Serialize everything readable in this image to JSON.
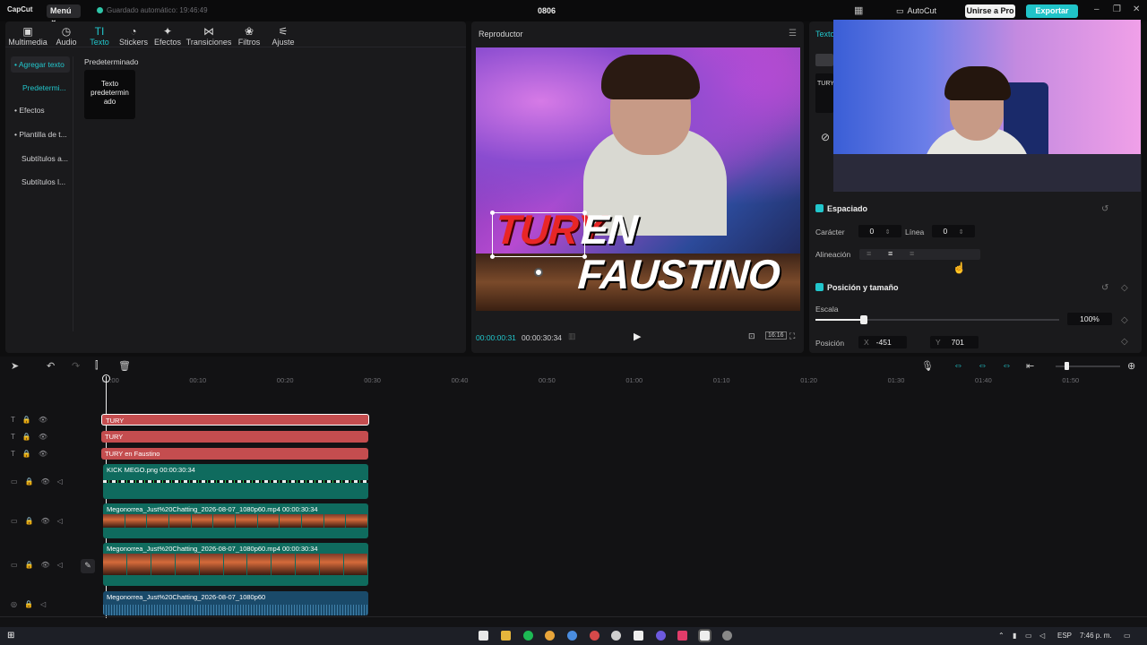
{
  "app": {
    "logo": "CapCut",
    "menu_label": "Menú ⌄",
    "autosave": "Guardado automático: 19:46:49",
    "project_title": "0806",
    "autocut_label": "AutoCut",
    "pro_label": "Unirse a Pro",
    "export_label": "Exportar"
  },
  "tabs": [
    {
      "label": "Multimedia",
      "icon": "media-icon"
    },
    {
      "label": "Audio",
      "icon": "audio-icon"
    },
    {
      "label": "Texto",
      "icon": "text-icon"
    },
    {
      "label": "Stickers",
      "icon": "sticker-icon"
    },
    {
      "label": "Efectos",
      "icon": "effects-icon"
    },
    {
      "label": "Transiciones",
      "icon": "transition-icon"
    },
    {
      "label": "Filtros",
      "icon": "filter-icon"
    },
    {
      "label": "Ajuste",
      "icon": "adjust-icon"
    }
  ],
  "sidenav": [
    "• Agregar texto",
    "Predetermi...",
    "• Efectos",
    "• Plantilla de t...",
    "Subtítulos a...",
    "Subtítulos l..."
  ],
  "presets": {
    "title": "Predeterminado",
    "card": "Texto predetermin ado"
  },
  "player": {
    "title": "Reproductor",
    "time_current": "00:00:00:31",
    "time_total": "00:00:30:34",
    "ratio": "16:16",
    "overlay_red": "TURY",
    "overlay_white": "EN FAUSTINO"
  },
  "right": {
    "tab": "Texto",
    "spacing": {
      "title": "Espaciado",
      "char_label": "Carácter",
      "char_value": "0",
      "line_label": "Línea",
      "line_value": "0",
      "align_label": "Alineación"
    },
    "pos": {
      "title": "Posición y tamaño",
      "scale_label": "Escala",
      "scale_value": "100%",
      "scale_fraction": 0.2,
      "position_label": "Posición",
      "x_label": "X",
      "x_value": "-451",
      "y_label": "Y",
      "y_value": "701"
    }
  },
  "timeline": {
    "ruler": [
      "00:00",
      "00:10",
      "00:20",
      "00:30",
      "00:40",
      "00:50",
      "01:00",
      "01:10",
      "01:20",
      "01:30",
      "01:40",
      "01:50"
    ],
    "tracks": [
      {
        "type": "text",
        "label": "TURY"
      },
      {
        "type": "text",
        "label": "TURY"
      },
      {
        "type": "text",
        "label": "TURY en Faustino"
      },
      {
        "type": "image",
        "label": "KICK MEGO.png  00:00:30:34"
      },
      {
        "type": "video",
        "label": "Megonorrea_Just%20Chatting_2026-08-07_1080p60.mp4  00:00:30:34"
      },
      {
        "type": "video",
        "label": "Megonorrea_Just%20Chatting_2026-08-07_1080p60.mp4  00:00:30:34"
      },
      {
        "type": "audio",
        "label": "Megonorrea_Just%20Chatting_2026-08-07_1080p60"
      }
    ]
  },
  "taskbar": {
    "lang": "ESP",
    "clock": "7:46 p. m."
  }
}
